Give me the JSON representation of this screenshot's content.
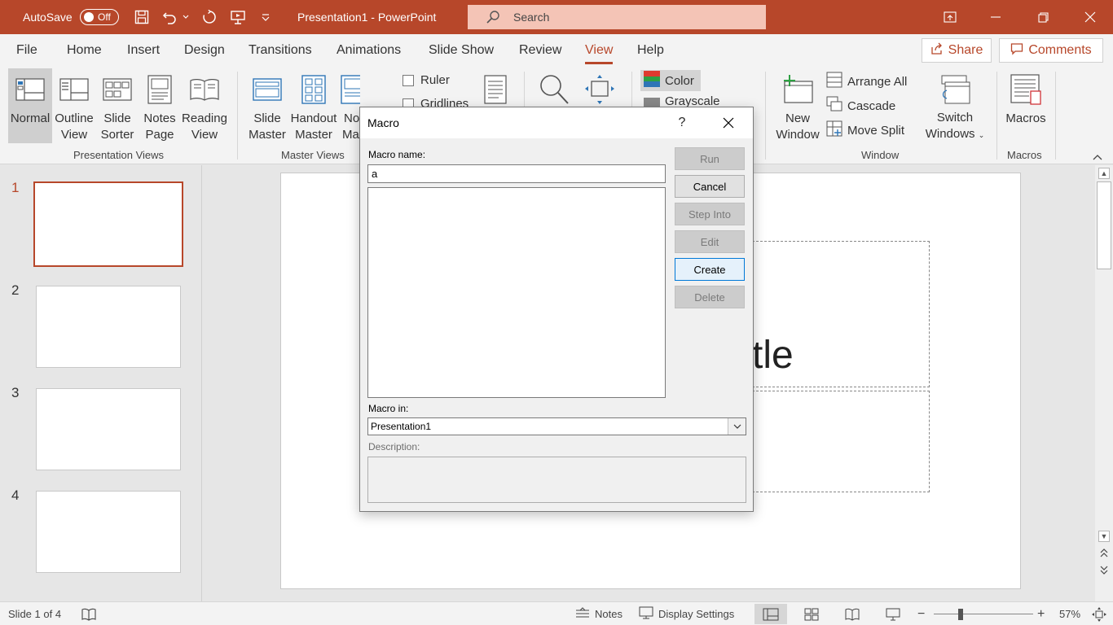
{
  "titlebar": {
    "autosave_label": "AutoSave",
    "autosave_state": "Off",
    "document_title": "Presentation1  -  PowerPoint",
    "search_placeholder": "Search"
  },
  "tabs": [
    "File",
    "Home",
    "Insert",
    "Design",
    "Transitions",
    "Animations",
    "Slide Show",
    "Review",
    "View",
    "Help"
  ],
  "active_tab": "View",
  "share_label": "Share",
  "comments_label": "Comments",
  "ribbon": {
    "presentation_views": {
      "group_label": "Presentation Views",
      "buttons": [
        {
          "line1": "Normal",
          "line2": ""
        },
        {
          "line1": "Outline",
          "line2": "View"
        },
        {
          "line1": "Slide",
          "line2": "Sorter"
        },
        {
          "line1": "Notes",
          "line2": "Page"
        },
        {
          "line1": "Reading",
          "line2": "View"
        }
      ]
    },
    "master_views": {
      "group_label": "Master Views",
      "buttons": [
        {
          "line1": "Slide",
          "line2": "Master"
        },
        {
          "line1": "Handout",
          "line2": "Master"
        },
        {
          "line1": "No",
          "line2": "Ma"
        }
      ]
    },
    "show": {
      "ruler": "Ruler",
      "gridlines": "Gridlines"
    },
    "color": {
      "color": "Color",
      "grayscale": "Grayscale"
    },
    "window": {
      "group_label": "Window",
      "new_window": {
        "line1": "New",
        "line2": "Window"
      },
      "arrange_all": "Arrange All",
      "cascade": "Cascade",
      "move_split": "Move Split",
      "switch_windows": {
        "line1": "Switch",
        "line2": "Windows"
      }
    },
    "macros": {
      "group_label": "Macros",
      "button": "Macros"
    }
  },
  "thumbnails": [
    "1",
    "2",
    "3",
    "4"
  ],
  "slide": {
    "title_fragment": "tle"
  },
  "statusbar": {
    "slide_info": "Slide 1 of 4",
    "notes": "Notes",
    "display_settings": "Display Settings",
    "zoom": "57%"
  },
  "dialog": {
    "title": "Macro",
    "help": "?",
    "macro_name_label": "Macro name:",
    "macro_name_value": "a",
    "macro_in_label": "Macro in:",
    "macro_in_value": "Presentation1",
    "description_label": "Description:",
    "buttons": {
      "run": "Run",
      "cancel": "Cancel",
      "step_into": "Step Into",
      "edit": "Edit",
      "create": "Create",
      "delete": "Delete"
    }
  },
  "colors": {
    "accent": "#b7472a",
    "ribbon_bg": "#f3f3f3",
    "canvas_bg": "#e6e6e6"
  }
}
